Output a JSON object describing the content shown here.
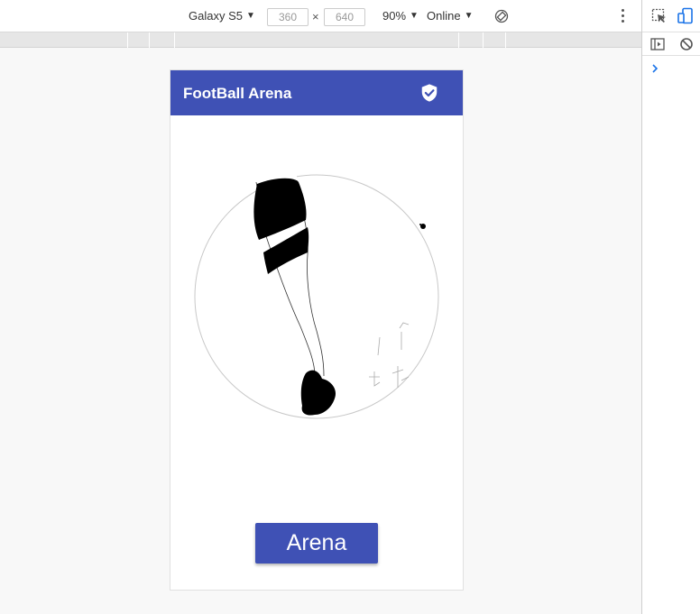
{
  "toolbar": {
    "device": "Galaxy S5",
    "width_value": "360",
    "height_value": "640",
    "dim_separator": "×",
    "zoom": "90%",
    "network": "Online"
  },
  "app": {
    "title": "FootBall Arena",
    "button_label": "Arena",
    "brand_color": "#3f51b5"
  },
  "icons": {
    "rotate": "rotate-icon",
    "more": "more-vert-icon",
    "inspect": "inspect-icon",
    "device_toggle": "device-toggle-icon",
    "sidebar": "sidebar-toggle-icon",
    "clear": "clear-console-icon",
    "prompt": "console-prompt-icon",
    "shield": "shield-check-icon"
  }
}
